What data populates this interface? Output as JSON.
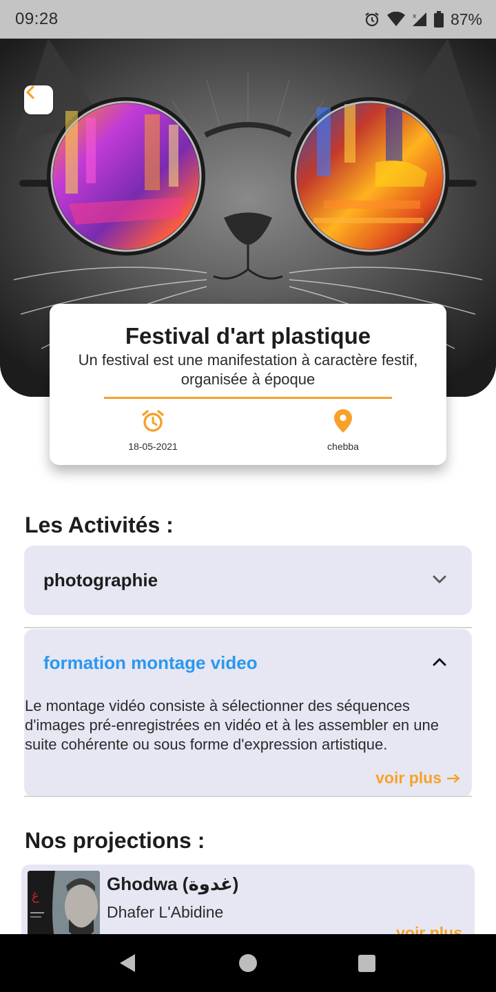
{
  "status_bar": {
    "time": "09:28",
    "battery": "87%",
    "icons": [
      "alarm-icon",
      "wifi-icon",
      "cell-signal-icon",
      "battery-icon"
    ]
  },
  "hero": {
    "image": "cat-with-round-sunglasses-reflecting-city-lights",
    "back_icon": "chevron-left-icon"
  },
  "event": {
    "title": "Festival d'art plastique",
    "description": "Un festival est une manifestation à caractère festif, organisée à époque",
    "date": "18-05-2021",
    "location": "chebba",
    "date_icon": "alarm-clock-icon",
    "location_icon": "location-pin-icon"
  },
  "activities": {
    "title": "Les Activités :",
    "items": [
      {
        "label": "photographie",
        "expanded": false,
        "chevron": "chevron-down-icon"
      },
      {
        "label": "formation montage video",
        "expanded": true,
        "chevron": "chevron-up-icon",
        "description": "Le montage vidéo consiste à sélectionner des séquences d'images pré-enregistrées en vidéo et à les assembler en une suite cohérente ou sous forme d'expression artistique.",
        "more_label": "voir plus",
        "more_icon": "arrow-right-icon"
      }
    ]
  },
  "projections": {
    "title": "Nos projections :",
    "items": [
      {
        "title": "Ghodwa (غدوة)",
        "director": "Dhafer L'Abidine",
        "more_label": "voir plus"
      }
    ]
  },
  "nav_bar": {
    "icons": [
      "nav-back-icon",
      "nav-home-icon",
      "nav-recents-icon"
    ]
  },
  "colors": {
    "accent": "#f7a12a",
    "link_blue": "#2a97ee",
    "card_bg": "#e6e7f3",
    "status_bar": "#c4c4c4"
  }
}
